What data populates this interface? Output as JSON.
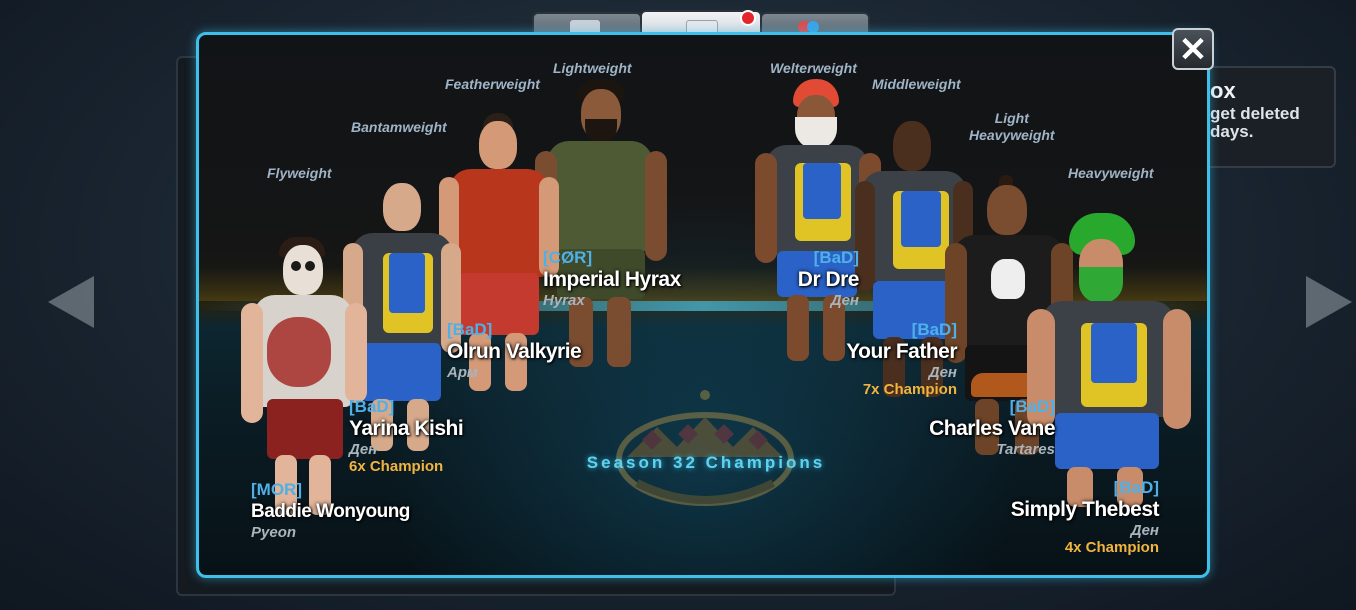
{
  "side_card": {
    "title": "ox",
    "text_line1": "get deleted",
    "text_line2": "days."
  },
  "close_label": "✕",
  "season_title": "Season 32 Champions",
  "divisions": {
    "flyweight": "Flyweight",
    "bantamweight": "Bantamweight",
    "featherweight": "Featherweight",
    "lightweight": "Lightweight",
    "welterweight": "Welterweight",
    "middleweight": "Middleweight",
    "light_heavyweight_line1": "Light",
    "light_heavyweight_line2": "Heavyweight",
    "heavyweight": "Heavyweight"
  },
  "champions": {
    "flyweight": {
      "clan": "[MOR]",
      "name": "Baddie Wonyoung",
      "country": "Pyeon",
      "titles": ""
    },
    "bantamweight": {
      "clan": "[BaD]",
      "name": "Yarina Kishi",
      "country": "Ден",
      "titles": "6x Champion"
    },
    "featherweight": {
      "clan": "[BaD]",
      "name": "Olrun Valkyrie",
      "country": "Арм",
      "titles": ""
    },
    "lightweight": {
      "clan": "[CØR]",
      "name": "Imperial Hyrax",
      "country": "Hyrax",
      "titles": ""
    },
    "welterweight": {
      "clan": "[BaD]",
      "name": "Dr Dre",
      "country": "Ден",
      "titles": ""
    },
    "middleweight": {
      "clan": "[BaD]",
      "name": "Your Father",
      "country": "Ден",
      "titles": "7x Champion"
    },
    "light_heavyweight": {
      "clan": "[BaD]",
      "name": "Charles Vane",
      "country": "Tartares",
      "titles": ""
    },
    "heavyweight": {
      "clan": "[BaD]",
      "name": "Simply Thebest",
      "country": "Ден",
      "titles": "4x Champion"
    }
  },
  "colors": {
    "panel_border": "#3ec0ea",
    "clan_tag": "#4fb0e8",
    "champion_text": "#f1b53e",
    "season_text": "#5ed3f0",
    "division_text": "#9fb4c6"
  }
}
